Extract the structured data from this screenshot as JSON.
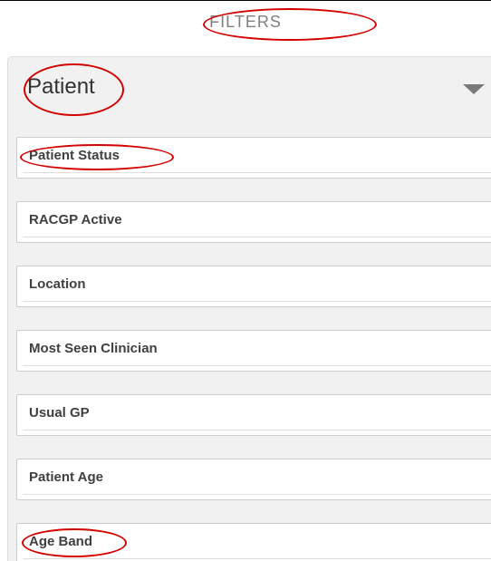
{
  "header": {
    "title": "FILTERS"
  },
  "group": {
    "title": "Patient",
    "toggle_icon": "caret-down-icon"
  },
  "filters": [
    {
      "label": "Patient Status"
    },
    {
      "label": "RACGP Active"
    },
    {
      "label": "Location"
    },
    {
      "label": "Most Seen Clinician"
    },
    {
      "label": "Usual GP"
    },
    {
      "label": "Patient Age"
    },
    {
      "label": "Age Band"
    }
  ],
  "annotations": {
    "color": "#d40000",
    "highlighted": [
      "FILTERS",
      "Patient",
      "Patient Status",
      "Age Band"
    ]
  }
}
